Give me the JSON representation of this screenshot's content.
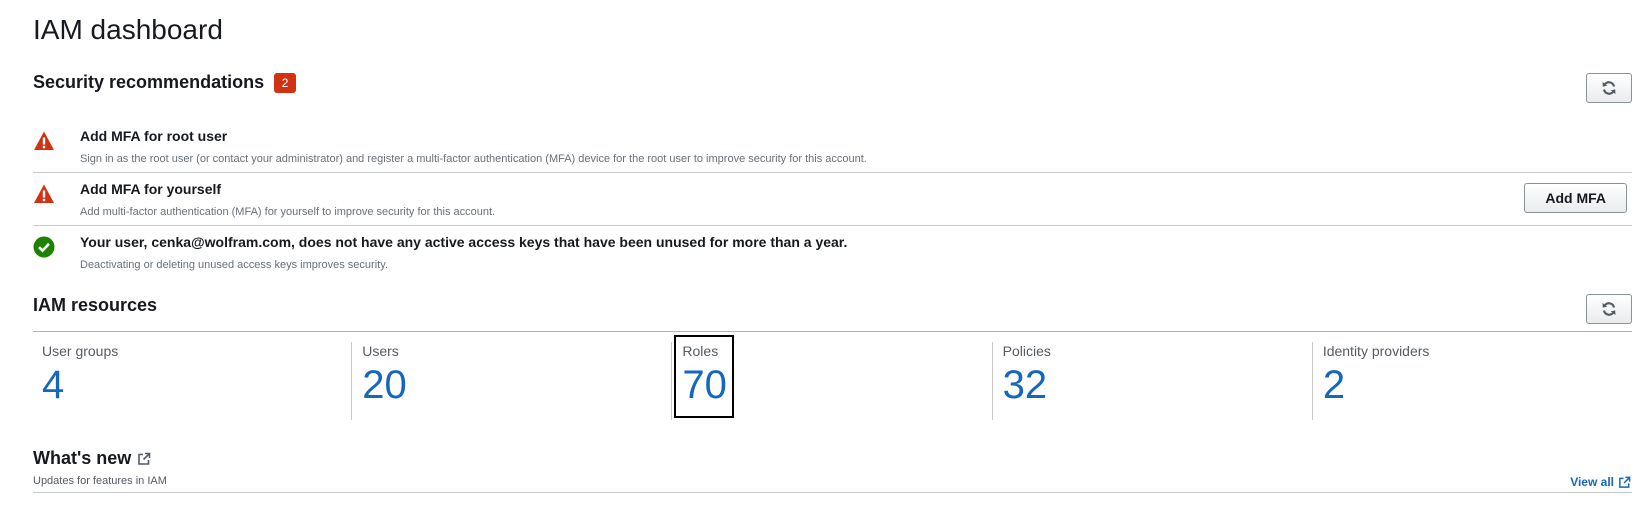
{
  "page": {
    "title": "IAM dashboard"
  },
  "security": {
    "title": "Security recommendations",
    "badge_count": "2",
    "refresh_icon": "refresh-icon",
    "recommendations": [
      {
        "status": "warning",
        "icon": "warning-icon",
        "title": "Add MFA for root user",
        "description": "Sign in as the root user (or contact your administrator) and register a multi-factor authentication (MFA) device for the root user to improve security for this account."
      },
      {
        "status": "warning",
        "icon": "warning-icon",
        "title": "Add MFA for yourself",
        "description": "Add multi-factor authentication (MFA) for yourself to improve security for this account.",
        "action_label": "Add MFA"
      },
      {
        "status": "ok",
        "icon": "check-circle-icon",
        "title": "Your user, cenka@wolfram.com, does not have any active access keys that have been unused for more than a year.",
        "description": "Deactivating or deleting unused access keys improves security."
      }
    ]
  },
  "resources": {
    "title": "IAM resources",
    "refresh_icon": "refresh-icon",
    "items": [
      {
        "label": "User groups",
        "count": "4"
      },
      {
        "label": "Users",
        "count": "20"
      },
      {
        "label": "Roles",
        "count": "70"
      },
      {
        "label": "Policies",
        "count": "32"
      },
      {
        "label": "Identity providers",
        "count": "2"
      }
    ]
  },
  "whats_new": {
    "title": "What's new",
    "subtitle": "Updates for features in IAM",
    "view_all_label": "View all",
    "external_icon": "external-link-icon"
  },
  "colors": {
    "warning": "#d13212",
    "success": "#1d8102",
    "link": "#1566c0",
    "badge": "#d13212"
  }
}
